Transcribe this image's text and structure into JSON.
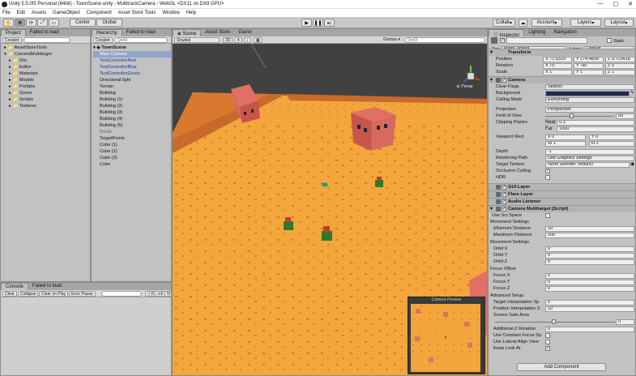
{
  "window": {
    "title": "Unity 5.5.0f3 Personal (64bit) - TownScene.unity - MultitrackCamera - WebGL <DX11 on DX9 GPU>"
  },
  "menu": [
    "File",
    "Edit",
    "Assets",
    "GameObject",
    "Component",
    "Asset Store Tools",
    "Window",
    "Help"
  ],
  "toolbar": {
    "center": "Center",
    "global": "Global",
    "collab": "Collab",
    "account": "Account",
    "layers": "Layers",
    "layout": "Layout"
  },
  "project": {
    "tabs": [
      "Project",
      "Failed to load"
    ],
    "create": "Create",
    "tree": [
      "AssetStoreTools",
      "CameraMultitarget",
      "Doc",
      "Editor",
      "Materials",
      "Models",
      "Prefabs",
      "Scene",
      "Scripts",
      "Textures"
    ]
  },
  "hierarchy": {
    "tabs": [
      "Hierarchy",
      "Failed to load"
    ],
    "create": "Create",
    "search": "Q▾All",
    "scene": "TownScene",
    "items": [
      {
        "label": "Main Camera",
        "style": "sel"
      },
      {
        "label": "TestControllerRed",
        "style": "blue"
      },
      {
        "label": "TestControllerBlue",
        "style": "blue"
      },
      {
        "label": "TestControllerGreen",
        "style": "blue"
      },
      {
        "label": "Directional light",
        "style": ""
      },
      {
        "label": "Terrain",
        "style": ""
      },
      {
        "label": "Building",
        "style": ""
      },
      {
        "label": "Building (1)",
        "style": ""
      },
      {
        "label": "Building (2)",
        "style": ""
      },
      {
        "label": "Building (3)",
        "style": ""
      },
      {
        "label": "Building (4)",
        "style": ""
      },
      {
        "label": "Building (5)",
        "style": ""
      },
      {
        "label": "Bomb",
        "style": "grey"
      },
      {
        "label": "TargetPoints",
        "style": ""
      },
      {
        "label": "Cube (1)",
        "style": ""
      },
      {
        "label": "Cube (2)",
        "style": ""
      },
      {
        "label": "Cube (3)",
        "style": ""
      },
      {
        "label": "Cube",
        "style": ""
      }
    ]
  },
  "console": {
    "tabs": [
      "Console",
      "Failed to load"
    ],
    "buttons": [
      "Clear",
      "Collapse",
      "Clear on Play",
      "Error Pause"
    ]
  },
  "scene": {
    "tabs": [
      "Scene",
      "Asset Store",
      "Game"
    ],
    "shaded": "Shaded",
    "mode2d": "2D",
    "gizmos": "Gizmos ▾",
    "search": "Q▾All",
    "persp": "≼ Persp",
    "preview_title": "Camera Preview"
  },
  "inspector": {
    "tabs": [
      "Inspector",
      "Lighting",
      "Navigation"
    ],
    "static": "Static",
    "tag_label": "Tag",
    "tag": "MainCamera",
    "layer_label": "Layer",
    "layer": "Default",
    "transform": {
      "title": "Transform",
      "position_label": "Position",
      "position": [
        "71.6329",
        "174.4839",
        "9.723418"
      ],
      "rotation_label": "Rotation",
      "rotation": [
        "75",
        "-90",
        "0"
      ],
      "scale_label": "Scale",
      "scale": [
        "1",
        "1",
        "1"
      ]
    },
    "camera": {
      "title": "Camera",
      "clear_flags_label": "Clear Flags",
      "clear_flags": "Skybox",
      "background_label": "Background",
      "culling_label": "Culling Mask",
      "culling": "Everything",
      "projection_label": "Projection",
      "projection": "Perspective",
      "fov_label": "Field of View",
      "fov": "60",
      "clip_label": "Clipping Planes",
      "near_label": "Near",
      "near": "0.3",
      "far_label": "Far",
      "far": "1000",
      "viewport_label": "Viewport Rect",
      "vx": "0",
      "vy": "0",
      "vw": "1",
      "vh": "1",
      "depth_label": "Depth",
      "depth": "-1",
      "render_path_label": "Rendering Path",
      "render_path": "Use Graphics Settings",
      "target_tex_label": "Target Texture",
      "target_tex": "None (Render Texture)",
      "occlusion_label": "Occlusion Culling",
      "hdr_label": "HDR"
    },
    "gui_layer": "GUI Layer",
    "flare_layer": "Flare Layer",
    "audio_listener": "Audio Listener",
    "script": {
      "title": "Camera Multitarget (Script)",
      "use_safe_label": "Use Scr.Space",
      "movement_label": "Movement Settings",
      "min_dist_label": "Minimum Distance",
      "min_dist": "10",
      "max_dist_label": "Maximum Distance",
      "max_dist": "200",
      "orbit_label": "Movement Settings",
      "orbitx_label": "Orbit X",
      "orbitx": "0",
      "orbity_label": "Orbit Y",
      "orbity": "0",
      "orbitz_label": "Orbit Z",
      "orbitz": "0",
      "focus_offset_label": "Focus Offset",
      "focusx_label": "Focus X",
      "focusx": "0",
      "focusy_label": "Focus Y",
      "focusy": "0",
      "focusz_label": "Focus Z",
      "focusz": "0",
      "advanced_label": "Advanced Setup",
      "tip_label": "Target Interpolation Sp",
      "tip": "5",
      "pip_label": "Position Interpolation S",
      "pip": "10",
      "safe_area_label": "Screen Safe Area",
      "safe_area": "0",
      "add_z_label": "Additional Z Rotation",
      "add_z": "0",
      "const_focus_label": "Use Constant Focus Sp",
      "lateral_label": "Use Lateral Align View",
      "keep_look_label": "Keep Look At"
    },
    "add_component": "Add Component"
  },
  "colors": {
    "ground": "#f3a63c",
    "sky": "#424242",
    "accent": "#3e5f96"
  }
}
